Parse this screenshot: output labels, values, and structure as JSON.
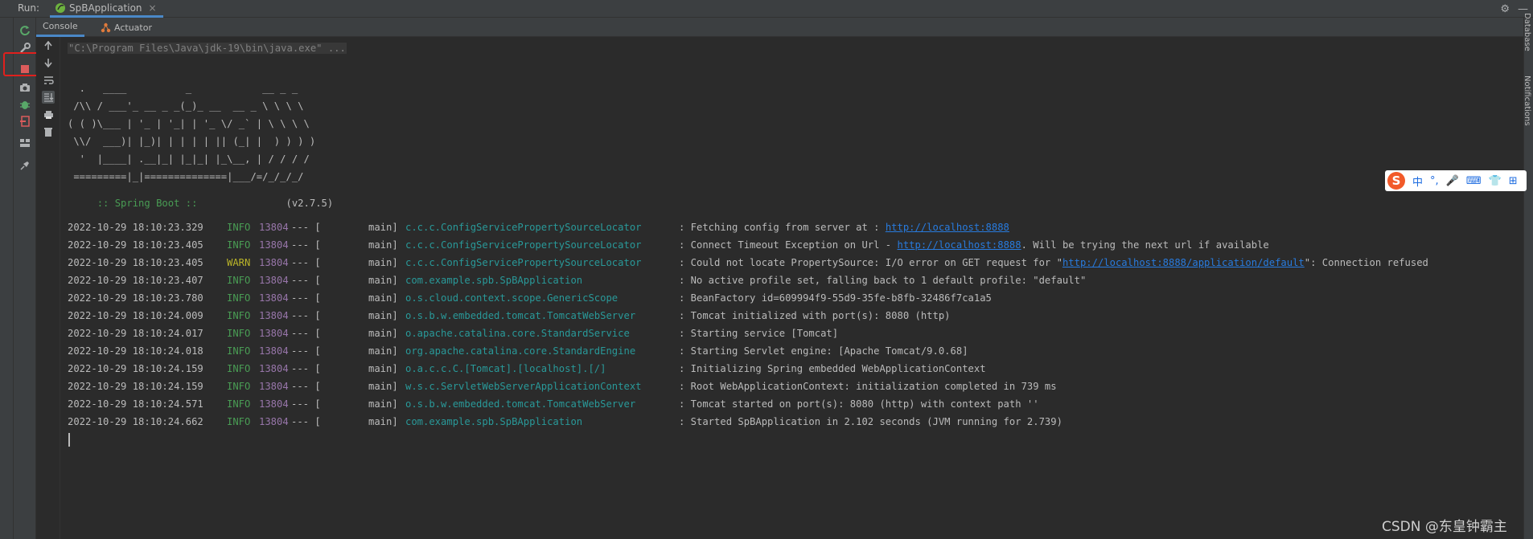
{
  "run_bar": {
    "label": "Run:",
    "tab_title": "SpBApplication",
    "tab_close": "×"
  },
  "right_strip": {
    "database_label": "Database",
    "notifications_label": "Notifications"
  },
  "sub_tabs": [
    {
      "label": "Console"
    },
    {
      "label": "Actuator"
    }
  ],
  "console": {
    "command_line": "\"C:\\Program Files\\Java\\jdk-19\\bin\\java.exe\" ...",
    "banner": "  .   ____          _            __ _ _\n /\\\\ / ___'_ __ _ _(_)_ __  __ _ \\ \\ \\ \\\n( ( )\\___ | '_ | '_| | '_ \\/ _` | \\ \\ \\ \\\n \\\\/  ___)| |_)| | | | | || (_| |  ) ) ) )\n  '  |____| .__|_| |_|_| |_\\__, | / / / /\n =========|_|==============|___/=/_/_/_/",
    "boot_label": " :: Spring Boot :: ",
    "boot_version": "              (v2.7.5)",
    "log_rows": [
      {
        "ts": "2022-10-29 18:10:23.329",
        "level": "INFO",
        "pid": "13804",
        "sep": "--- [",
        "thread": "main]",
        "logger": "c.c.c.ConfigServicePropertySourceLocator",
        "msg": ": Fetching config from server at : ",
        "link": "http://localhost:8888",
        "msg_after": ""
      },
      {
        "ts": "2022-10-29 18:10:23.405",
        "level": "INFO",
        "pid": "13804",
        "sep": "--- [",
        "thread": "main]",
        "logger": "c.c.c.ConfigServicePropertySourceLocator",
        "msg": ": Connect Timeout Exception on Url - ",
        "link": "http://localhost:8888",
        "msg_after": ". Will be trying the next url if available"
      },
      {
        "ts": "2022-10-29 18:10:23.405",
        "level": "WARN",
        "pid": "13804",
        "sep": "--- [",
        "thread": "main]",
        "logger": "c.c.c.ConfigServicePropertySourceLocator",
        "msg": ": Could not locate PropertySource: I/O error on GET request for \"",
        "link": "http://localhost:8888/application/default",
        "msg_after": "\": Connection refused"
      },
      {
        "ts": "2022-10-29 18:10:23.407",
        "level": "INFO",
        "pid": "13804",
        "sep": "--- [",
        "thread": "main]",
        "logger": "com.example.spb.SpBApplication",
        "msg": ": No active profile set, falling back to 1 default profile: \"default\"",
        "link": "",
        "msg_after": ""
      },
      {
        "ts": "2022-10-29 18:10:23.780",
        "level": "INFO",
        "pid": "13804",
        "sep": "--- [",
        "thread": "main]",
        "logger": "o.s.cloud.context.scope.GenericScope",
        "msg": ": BeanFactory id=609994f9-55d9-35fe-b8fb-32486f7ca1a5",
        "link": "",
        "msg_after": ""
      },
      {
        "ts": "2022-10-29 18:10:24.009",
        "level": "INFO",
        "pid": "13804",
        "sep": "--- [",
        "thread": "main]",
        "logger": "o.s.b.w.embedded.tomcat.TomcatWebServer",
        "msg": ": Tomcat initialized with port(s): 8080 (http)",
        "link": "",
        "msg_after": ""
      },
      {
        "ts": "2022-10-29 18:10:24.017",
        "level": "INFO",
        "pid": "13804",
        "sep": "--- [",
        "thread": "main]",
        "logger": "o.apache.catalina.core.StandardService",
        "msg": ": Starting service [Tomcat]",
        "link": "",
        "msg_after": ""
      },
      {
        "ts": "2022-10-29 18:10:24.018",
        "level": "INFO",
        "pid": "13804",
        "sep": "--- [",
        "thread": "main]",
        "logger": "org.apache.catalina.core.StandardEngine",
        "msg": ": Starting Servlet engine: [Apache Tomcat/9.0.68]",
        "link": "",
        "msg_after": ""
      },
      {
        "ts": "2022-10-29 18:10:24.159",
        "level": "INFO",
        "pid": "13804",
        "sep": "--- [",
        "thread": "main]",
        "logger": "o.a.c.c.C.[Tomcat].[localhost].[/]",
        "msg": ": Initializing Spring embedded WebApplicationContext",
        "link": "",
        "msg_after": ""
      },
      {
        "ts": "2022-10-29 18:10:24.159",
        "level": "INFO",
        "pid": "13804",
        "sep": "--- [",
        "thread": "main]",
        "logger": "w.s.c.ServletWebServerApplicationContext",
        "msg": ": Root WebApplicationContext: initialization completed in 739 ms",
        "link": "",
        "msg_after": ""
      },
      {
        "ts": "2022-10-29 18:10:24.571",
        "level": "INFO",
        "pid": "13804",
        "sep": "--- [",
        "thread": "main]",
        "logger": "o.s.b.w.embedded.tomcat.TomcatWebServer",
        "msg": ": Tomcat started on port(s): 8080 (http) with context path ''",
        "link": "",
        "msg_after": ""
      },
      {
        "ts": "2022-10-29 18:10:24.662",
        "level": "INFO",
        "pid": "13804",
        "sep": "--- [",
        "thread": "main]",
        "logger": "com.example.spb.SpBApplication",
        "msg": ": Started SpBApplication in 2.102 seconds (JVM running for 2.739)",
        "link": "",
        "msg_after": ""
      }
    ]
  },
  "ime": {
    "logo": "S",
    "items": [
      "中",
      "°,",
      "🎤",
      "⌨",
      "👕",
      "⊞"
    ]
  },
  "watermark": "CSDN @东皇钟霸主",
  "colors": {
    "info": "#499c54",
    "warn": "#bbb529",
    "pid": "#9876aa",
    "logger": "#299999",
    "link": "#287bde",
    "stop_highlight": "#e0201d"
  }
}
